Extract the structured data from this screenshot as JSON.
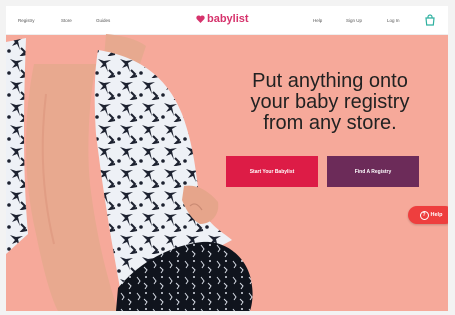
{
  "nav": {
    "links_left": [
      "Registry",
      "Store",
      "Guides"
    ],
    "brand": "babylist",
    "links_right": [
      "Help",
      "Sign Up",
      "Log In"
    ]
  },
  "hero": {
    "headline_lines": [
      "Put anything onto",
      "your baby registry",
      "from any store."
    ],
    "primary_button": "Start Your Babylist",
    "secondary_button": "Find A Registry"
  },
  "help_widget": {
    "label": "Help"
  },
  "colors": {
    "hero_bg": "#f6a99a",
    "primary": "#dd1c46",
    "secondary": "#6c2b59",
    "brand": "#d6336c",
    "help": "#ee3e3e"
  }
}
